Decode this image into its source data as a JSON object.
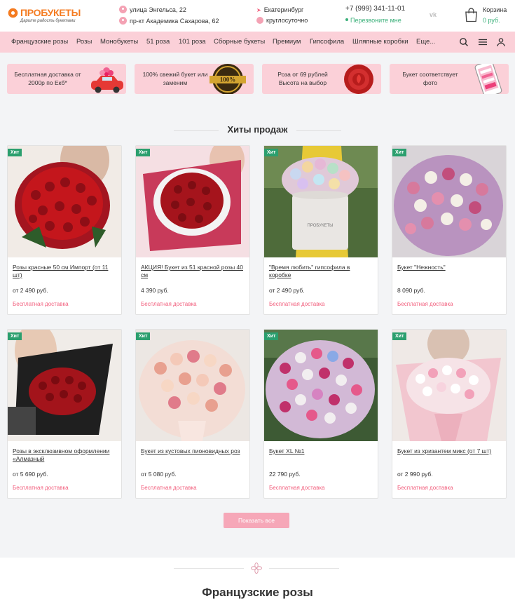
{
  "header": {
    "logo_text": "ПРОБУКЕТЫ",
    "logo_slogan": "Дарите радость букетами",
    "address_1": "улица Энгельса, 22",
    "address_2": "пр-кт Академика Сахарова, 62",
    "city": "Екатеринбург",
    "hours": "круглосуточно",
    "phone": "+7 (999) 341-11-01",
    "callback": "Перезвоните мне",
    "vk": "vk",
    "cart_label": "Корзина",
    "cart_sum": "0 руб."
  },
  "nav": {
    "items": [
      "Французские розы",
      "Розы",
      "Монобукеты",
      "51 роза",
      "101 роза",
      "Сборные букеты",
      "Премиум",
      "Гипсофила",
      "Шляпные коробки",
      "Еще..."
    ]
  },
  "features": [
    {
      "text": "Бесплатная доставка от 2000р по Екб*"
    },
    {
      "text": "100% свежий букет или заменим"
    },
    {
      "text": "Роза от 69 рублей Высота на выбор"
    },
    {
      "text": "Букет соответствует фото"
    }
  ],
  "section": {
    "title": "Хиты продаж"
  },
  "products": [
    {
      "badge": "Хит",
      "name": "Розы красные 50 см Импорт (от 11 шт)",
      "price": "от 2 490 руб.",
      "delivery": "Бесплатная доставка"
    },
    {
      "badge": "Хит",
      "name": "АКЦИЯ! Букет из 51 красной розы 40 см",
      "price": "4 390 руб.",
      "delivery": "Бесплатная доставка"
    },
    {
      "badge": "Хит",
      "name": "\"Время любить\" гипсофила в коробке",
      "price": "от 2 490 руб.",
      "delivery": "Бесплатная доставка"
    },
    {
      "badge": "Хит",
      "name": "Букет \"Нежность\"",
      "price": "8 090 руб.",
      "delivery": "Бесплатная доставка"
    },
    {
      "badge": "Хит",
      "name": "Розы в эксклюзивном оформлении «Алмазный",
      "price": "от 5 690 руб.",
      "delivery": "Бесплатная доставка"
    },
    {
      "badge": "Хит",
      "name": "Букет из кустовых пионовидных роз",
      "price": "от 5 080 руб.",
      "delivery": "Бесплатная доставка"
    },
    {
      "badge": "Хит",
      "name": "Букет XL №1",
      "price": "22 790 руб.",
      "delivery": "Бесплатная доставка"
    },
    {
      "badge": "Хит",
      "name": "Букет из хризантем микс (от 7 шт)",
      "price": "от 2 990 руб.",
      "delivery": "Бесплатная доставка"
    }
  ],
  "show_all": "Показать все",
  "bottom_section": {
    "title": "Французские розы"
  },
  "colors": {
    "accent": "#f2607e",
    "nav_bg": "#fbd0d8",
    "badge": "#2b9f6e",
    "logo": "#f47b20",
    "green": "#3bb07a"
  }
}
